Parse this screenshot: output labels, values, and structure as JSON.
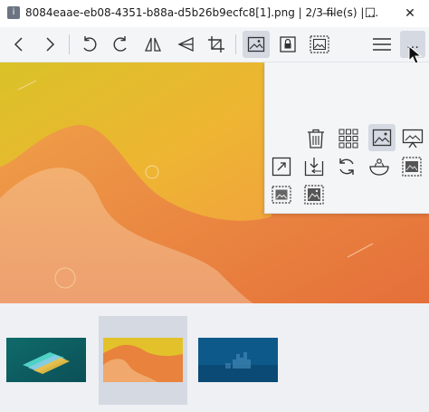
{
  "window": {
    "title": "8084eaae-eb08-4351-b88a-d5b26b9ecfc8[1].png  |  2/3 file(s)  |  …",
    "app_icon_glyph": "i",
    "minimize_glyph": "—",
    "maximize_glyph": "☐",
    "close_glyph": "✕"
  },
  "toolbar": {
    "items": [
      {
        "name": "previous-button",
        "icon": "chevron-left-icon"
      },
      {
        "name": "next-button",
        "icon": "chevron-right-icon"
      },
      {
        "name": "rotate-left-button",
        "icon": "rotate-ccw-icon"
      },
      {
        "name": "rotate-right-button",
        "icon": "rotate-cw-icon"
      },
      {
        "name": "flip-horizontal-button",
        "icon": "flip-horizontal-icon"
      },
      {
        "name": "flip-vertical-button",
        "icon": "flip-vertical-icon"
      },
      {
        "name": "crop-button",
        "icon": "crop-icon"
      },
      {
        "name": "image-button",
        "icon": "image-icon",
        "active": true
      },
      {
        "name": "lock-button",
        "icon": "lock-icon"
      },
      {
        "name": "image-frame-button",
        "icon": "image-dashed-icon"
      },
      {
        "name": "menu-button",
        "icon": "hamburger-icon"
      },
      {
        "name": "more-button",
        "icon": "more-dots-icon",
        "active": true
      }
    ],
    "more_label": "…"
  },
  "popup": {
    "items": [
      {
        "name": "delete-button",
        "icon": "trash-icon"
      },
      {
        "name": "gallery-grid-button",
        "icon": "grid-icon"
      },
      {
        "name": "image-view-button",
        "icon": "image-icon",
        "active": true
      },
      {
        "name": "slideshow-button",
        "icon": "presentation-icon"
      },
      {
        "name": "fit-window-button",
        "icon": "expand-icon"
      },
      {
        "name": "open-location-button",
        "icon": "import-icon"
      },
      {
        "name": "refresh-button",
        "icon": "refresh-icon"
      },
      {
        "name": "checkerboard-button",
        "icon": "bowl-icon"
      },
      {
        "name": "frame-button",
        "icon": "image-frame-icon"
      },
      {
        "name": "thumbnail-button",
        "icon": "image-dashed-icon"
      },
      {
        "name": "wallpaper-button",
        "icon": "image-wide-icon"
      }
    ]
  },
  "thumbnails": [
    {
      "name": "thumbnail-cards",
      "selected": false
    },
    {
      "name": "thumbnail-orange-waves",
      "selected": true
    },
    {
      "name": "thumbnail-blue-city",
      "selected": false
    }
  ],
  "colors": {
    "toolbar_bg": "#f4f5f7",
    "active_button": "#d4d9e2",
    "icon": "#333333",
    "orange": "#e8823c",
    "yellow": "#e3c12a"
  }
}
